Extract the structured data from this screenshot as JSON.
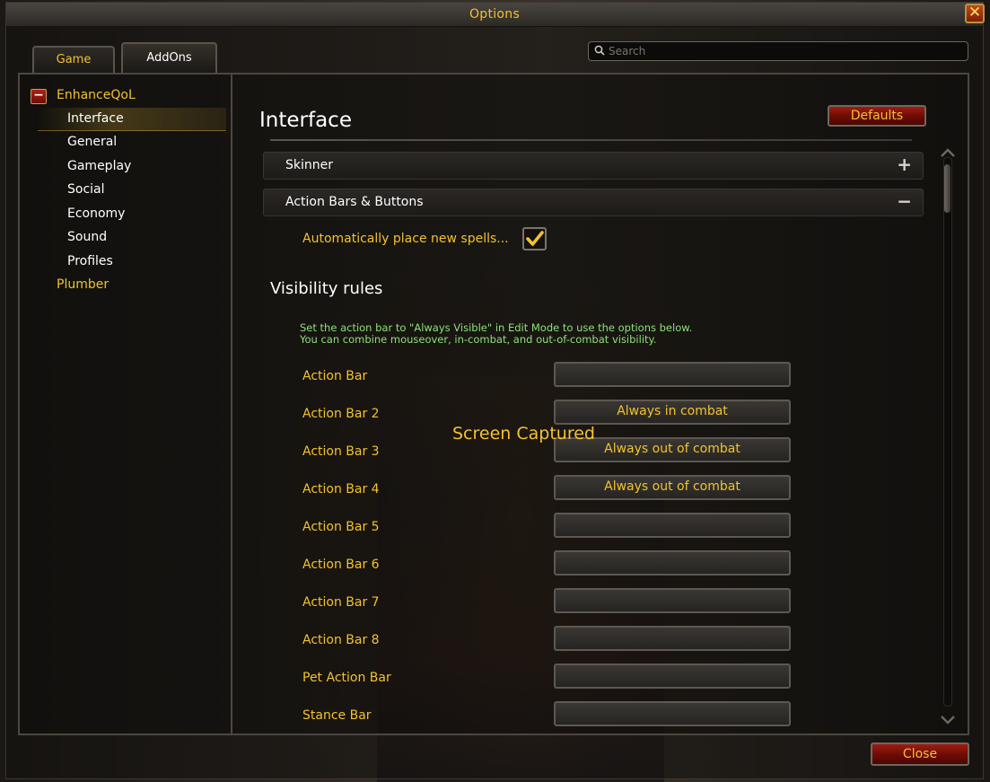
{
  "window": {
    "title": "Options",
    "close_glyph": "✕"
  },
  "tabs": [
    {
      "label": "Game",
      "active": false
    },
    {
      "label": "AddOns",
      "active": true
    }
  ],
  "search": {
    "placeholder": "Search",
    "value": ""
  },
  "sidebar": {
    "root": {
      "collapse_glyph": "−",
      "label": "EnhanceQoL"
    },
    "items": [
      {
        "label": "Interface",
        "selected": true
      },
      {
        "label": "General"
      },
      {
        "label": "Gameplay"
      },
      {
        "label": "Social"
      },
      {
        "label": "Economy"
      },
      {
        "label": "Sound"
      },
      {
        "label": "Profiles"
      }
    ],
    "other_addon": "Plumber"
  },
  "content": {
    "title": "Interface",
    "defaults_button": "Defaults",
    "sections": [
      {
        "label": "Skinner",
        "toggle": "+",
        "expanded": false
      },
      {
        "label": "Action Bars & Buttons",
        "toggle": "−",
        "expanded": true
      }
    ],
    "auto_place": {
      "label": "Automatically place new spells...",
      "checked": true
    },
    "visibility": {
      "heading": "Visibility rules",
      "info_line1": "Set the action bar to \"Always Visible\" in Edit Mode to use the options below.",
      "info_line2": "You can combine mouseover, in-combat, and out-of-combat visibility.",
      "rows": [
        {
          "label": "Action Bar",
          "value": ""
        },
        {
          "label": "Action Bar 2",
          "value": "Always in combat"
        },
        {
          "label": "Action Bar 3",
          "value": "Always out of combat"
        },
        {
          "label": "Action Bar 4",
          "value": "Always out of combat"
        },
        {
          "label": "Action Bar 5",
          "value": ""
        },
        {
          "label": "Action Bar 6",
          "value": ""
        },
        {
          "label": "Action Bar 7",
          "value": ""
        },
        {
          "label": "Action Bar 8",
          "value": ""
        },
        {
          "label": "Pet Action Bar",
          "value": ""
        },
        {
          "label": "Stance Bar",
          "value": ""
        }
      ]
    },
    "overlay": "Screen Captured"
  },
  "footer": {
    "close_button": "Close"
  },
  "colors": {
    "gold": "#f2c230",
    "info_green": "#8ee07a",
    "button_red": "#a01c10"
  },
  "icons": [
    "close-icon",
    "search-icon",
    "collapse-icon",
    "checkmark-icon",
    "expand-icon",
    "scroll-up-icon",
    "scroll-down-icon"
  ]
}
